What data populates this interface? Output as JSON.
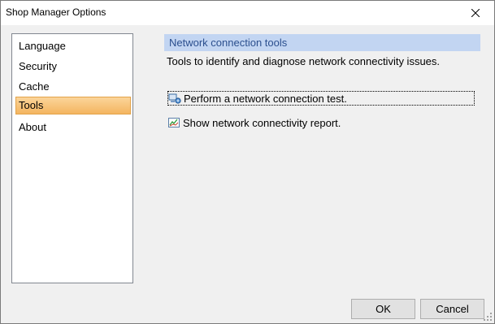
{
  "window": {
    "title": "Shop Manager Options",
    "close_icon": "close-icon"
  },
  "sidebar": {
    "items": [
      {
        "label": "Language",
        "selected": false
      },
      {
        "label": "Security",
        "selected": false
      },
      {
        "label": "Cache",
        "selected": false
      },
      {
        "label": "Tools",
        "selected": true
      },
      {
        "label": "About",
        "selected": false
      }
    ]
  },
  "content": {
    "header": "Network connection tools",
    "description": "Tools to identify and diagnose network connectivity issues.",
    "actions": [
      {
        "label": "Perform a network connection test.",
        "icon": "network-test-icon"
      },
      {
        "label": "Show network connectivity report.",
        "icon": "report-chart-icon"
      }
    ]
  },
  "buttons": {
    "ok": "OK",
    "cancel": "Cancel"
  },
  "colors": {
    "selection": "#f4b560",
    "header_bg": "#c2d5f2",
    "header_text": "#2b4f8e"
  }
}
